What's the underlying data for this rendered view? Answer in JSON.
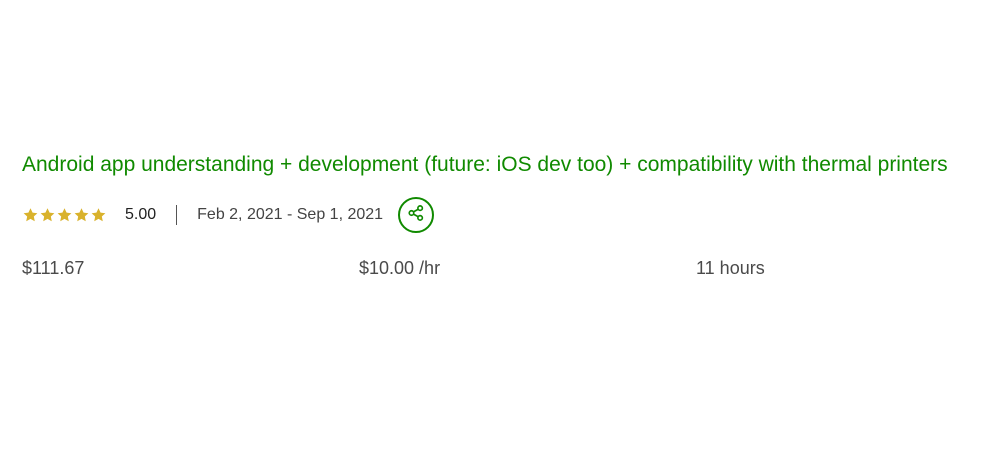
{
  "job": {
    "title": "Android app understanding + development (future: iOS dev too) + compatibility with thermal printers",
    "rating": {
      "stars": 5,
      "value": "5.00",
      "star_color": "#d9b22c"
    },
    "date_range": "Feb 2, 2021 - Sep 1, 2021",
    "share_icon": "share-icon",
    "accent_color": "#108a00",
    "total_earned": "$111.67",
    "hourly_rate": "$10.00 /hr",
    "hours": "11 hours"
  }
}
